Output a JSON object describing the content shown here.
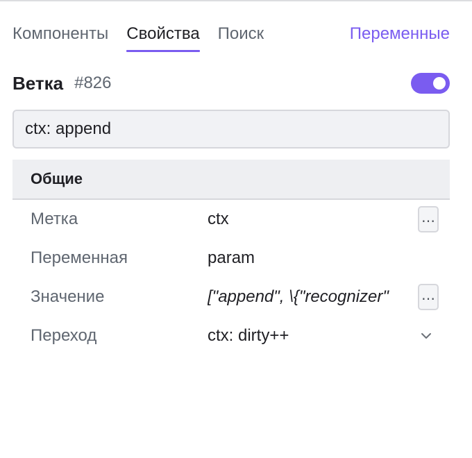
{
  "tabs": [
    {
      "label": "Компоненты",
      "active": false
    },
    {
      "label": "Свойства",
      "active": true
    },
    {
      "label": "Поиск",
      "active": false
    }
  ],
  "variables_tab": {
    "label": "Переменные"
  },
  "header": {
    "title": "Ветка",
    "id": "#826",
    "enabled": true
  },
  "name_input": {
    "value": "ctx: append"
  },
  "section": {
    "title": "Общие",
    "rows": [
      {
        "label": "Метка",
        "value": "ctx",
        "control": "more",
        "control_label": "…"
      },
      {
        "label": "Переменная",
        "value": "param",
        "control": "none"
      },
      {
        "label": "Значение",
        "value": "[\"append\", \\{\"recognizer\"",
        "control": "more",
        "control_label": "…"
      },
      {
        "label": "Переход",
        "value": "ctx: dirty++",
        "control": "dropdown"
      }
    ]
  },
  "colors": {
    "accent": "#7a5cf0",
    "text": "#1f1f24",
    "muted": "#5f6670",
    "section_bg": "#eeeff2",
    "border": "#d6d7dc"
  },
  "icons": {
    "toggle": "toggle-switch-icon",
    "more": "ellipsis-icon",
    "dropdown": "chevron-down-icon"
  }
}
